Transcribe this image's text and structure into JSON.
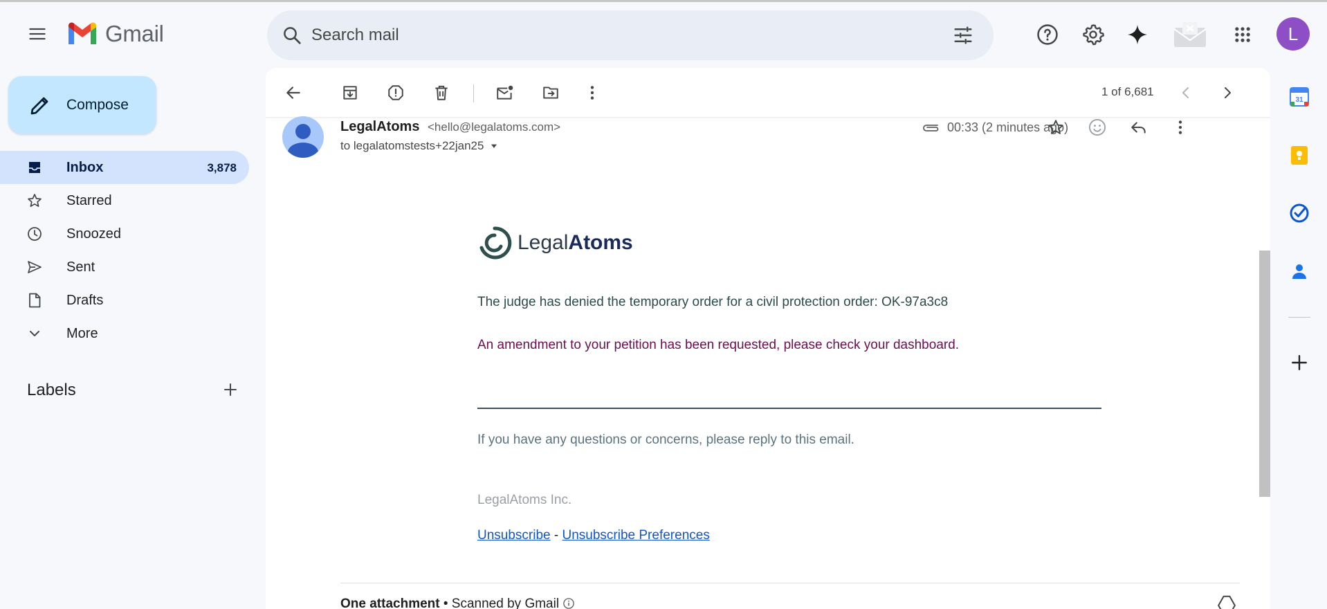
{
  "header": {
    "app_name": "Gmail",
    "search_placeholder": "Search mail",
    "avatar_letter": "L"
  },
  "compose": {
    "label": "Compose"
  },
  "nav": {
    "items": [
      {
        "label": "Inbox",
        "count": "3,878",
        "icon": "inbox-icon",
        "active": true
      },
      {
        "label": "Starred",
        "icon": "star-icon"
      },
      {
        "label": "Snoozed",
        "icon": "clock-icon"
      },
      {
        "label": "Sent",
        "icon": "send-icon"
      },
      {
        "label": "Drafts",
        "icon": "draft-icon"
      },
      {
        "label": "More",
        "icon": "chevron-down-icon"
      }
    ]
  },
  "labels": {
    "title": "Labels"
  },
  "toolbar": {
    "pager": "1 of 6,681"
  },
  "message": {
    "sender_name": "LegalAtoms",
    "sender_email": "<hello@legalatoms.com>",
    "recipient": "to legalatomstests+22jan25",
    "time": "00:33 (2 minutes ago)"
  },
  "email_body": {
    "brand_light": "Legal",
    "brand_bold": "Atoms",
    "line1": "The judge has denied the temporary order for a civil protection order: OK-97a3c8",
    "line2": "An amendment to your petition has been requested, please check your dashboard.",
    "line3": "If you have any questions or concerns, please reply to this email.",
    "company": "LegalAtoms Inc.",
    "unsubscribe": "Unsubscribe",
    "separator": "-",
    "unsubscribe_prefs": "Unsubscribe Preferences"
  },
  "attachments": {
    "title": "One attachment",
    "scanned": "• Scanned by Gmail"
  },
  "colors": {
    "accent": "#0b57d0",
    "active_nav": "#d3e3fd",
    "compose_bg": "#c2e7ff",
    "amendment_text": "#6a0f4f"
  }
}
